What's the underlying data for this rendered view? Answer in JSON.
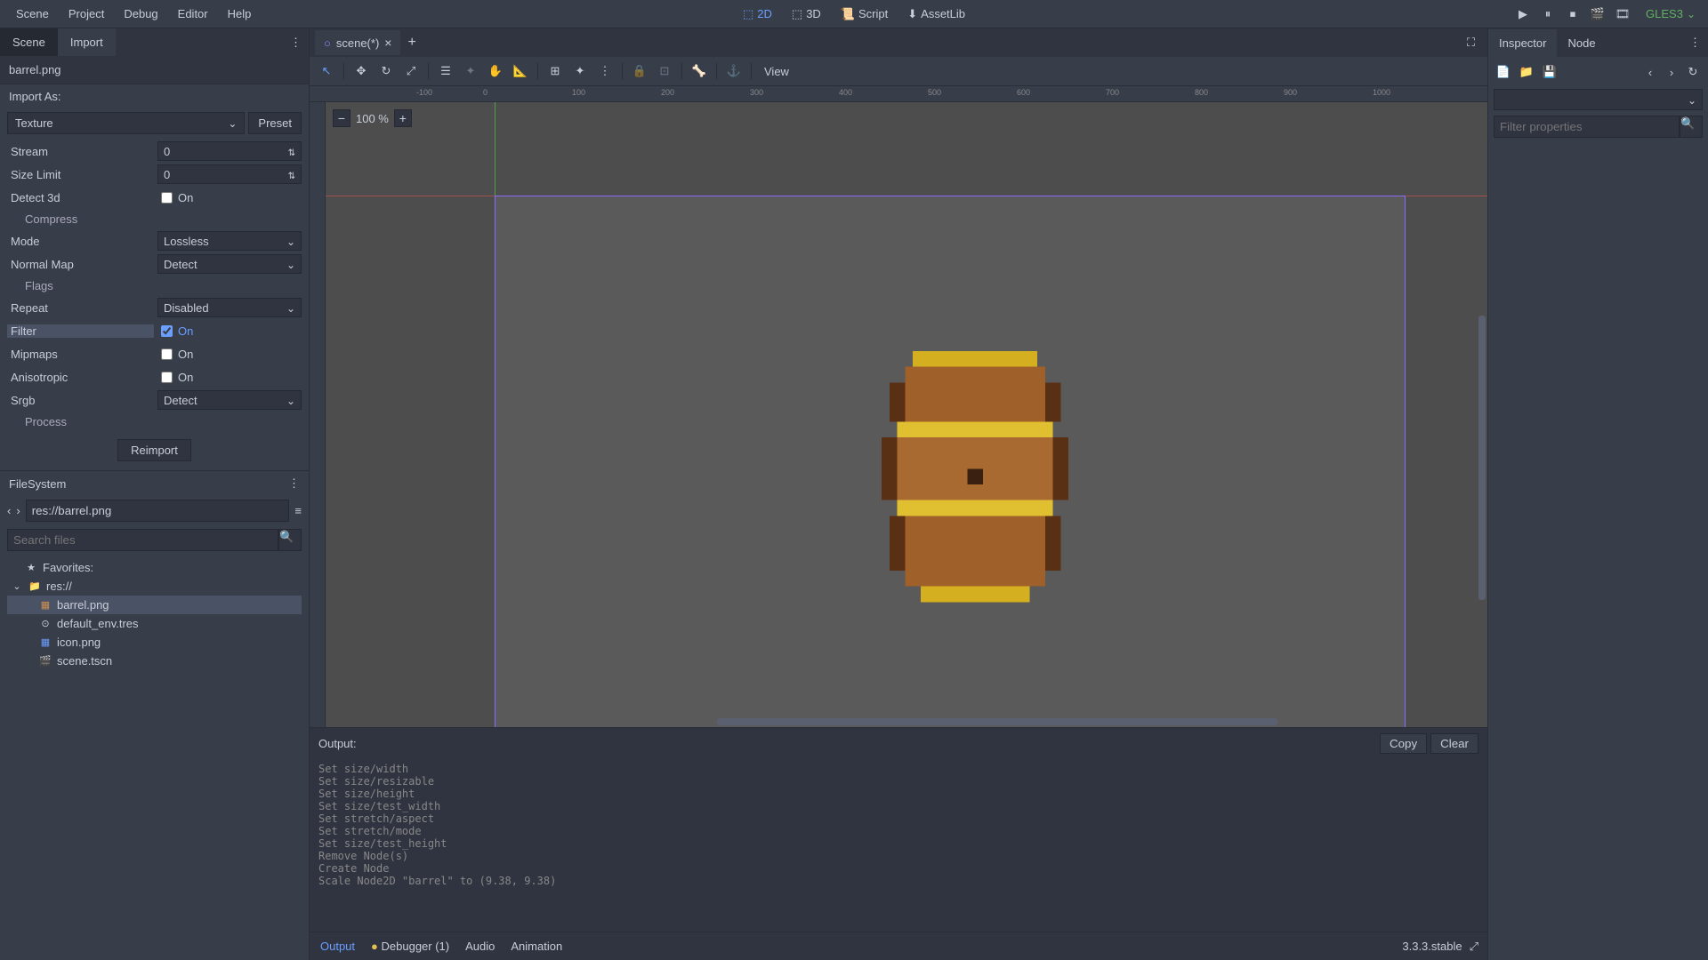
{
  "menubar": {
    "scene": "Scene",
    "project": "Project",
    "debug": "Debug",
    "editor": "Editor",
    "help": "Help",
    "mode_2d": "2D",
    "mode_3d": "3D",
    "mode_script": "Script",
    "mode_assetlib": "AssetLib",
    "renderer": "GLES3"
  },
  "left_tabs": {
    "scene": "Scene",
    "import": "Import"
  },
  "import": {
    "filename": "barrel.png",
    "import_as_label": "Import As:",
    "importer": "Texture",
    "preset_btn": "Preset",
    "props": {
      "stream_label": "Stream",
      "stream_value": "0",
      "sizelimit_label": "Size Limit",
      "sizelimit_value": "0",
      "detect3d_label": "Detect 3d",
      "detect3d_value": "On",
      "compress_section": "Compress",
      "mode_label": "Mode",
      "mode_value": "Lossless",
      "normalmap_label": "Normal Map",
      "normalmap_value": "Detect",
      "flags_section": "Flags",
      "repeat_label": "Repeat",
      "repeat_value": "Disabled",
      "filter_label": "Filter",
      "filter_value": "On",
      "mipmaps_label": "Mipmaps",
      "mipmaps_value": "On",
      "anisotropic_label": "Anisotropic",
      "anisotropic_value": "On",
      "srgb_label": "Srgb",
      "srgb_value": "Detect",
      "process_section": "Process"
    },
    "reimport_btn": "Reimport"
  },
  "filesystem": {
    "title": "FileSystem",
    "path": "res://barrel.png",
    "search_placeholder": "Search files",
    "favorites": "Favorites:",
    "root": "res://",
    "items": [
      "barrel.png",
      "default_env.tres",
      "icon.png",
      "scene.tscn"
    ]
  },
  "scene_tab": {
    "name": "scene(*)"
  },
  "viewport": {
    "zoom": "100 %",
    "view_label": "View"
  },
  "output": {
    "title": "Output:",
    "copy_btn": "Copy",
    "clear_btn": "Clear",
    "lines": "Set size/width\nSet size/resizable\nSet size/height\nSet size/test_width\nSet stretch/aspect\nSet stretch/mode\nSet size/test_height\nRemove Node(s)\nCreate Node\nScale Node2D \"barrel\" to (9.38, 9.38)"
  },
  "bottom_tabs": {
    "output": "Output",
    "debugger": "Debugger (1)",
    "audio": "Audio",
    "animation": "Animation",
    "version": "3.3.3.stable"
  },
  "inspector": {
    "tab_inspector": "Inspector",
    "tab_node": "Node",
    "filter_placeholder": "Filter properties"
  }
}
